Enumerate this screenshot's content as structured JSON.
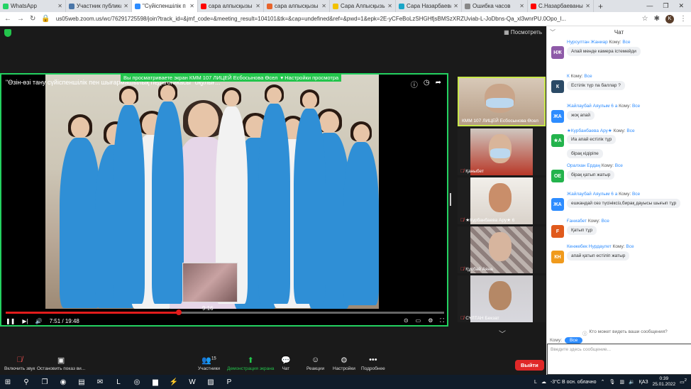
{
  "browser": {
    "tabs": [
      {
        "title": "WhatsApp",
        "color": "#25d366",
        "active": false
      },
      {
        "title": "Участник публикаци",
        "color": "#4a76a8",
        "active": false
      },
      {
        "title": "\"Сүйіспеншілік п",
        "color": "#2d8cff",
        "active": true
      },
      {
        "title": "сара алпысқызы назарбаева",
        "color": "#ff0000",
        "active": false
      },
      {
        "title": "сара алпысқызы на",
        "color": "#e8642c",
        "active": false
      },
      {
        "title": "Сара Алпысқызы На",
        "color": "#f2c200",
        "active": false
      },
      {
        "title": "Сара Назарбаева сл",
        "color": "#1aa6c8",
        "active": false
      },
      {
        "title": "Ошибка часов",
        "color": "#888888",
        "active": false
      },
      {
        "title": "С.Назарбаеваның т",
        "color": "#ff0000",
        "active": false
      }
    ],
    "url": "us05web.zoom.us/wc/76291725598/join?track_id=&jmf_code=&meeting_result=104101&tk=&cap=undefined&ref=&pwd=1&epk=2E-yCFeBoLzSHGHfjsBMSzXRZUviab-L-JoDbns-Qa_xl3wnrPU.0Opo_l...",
    "profile_initial": "K"
  },
  "zoom": {
    "view_button": "Посмотреть",
    "share_banner": "Вы просматриваете экран КММ 107 ЛИЦЕЙ Есбосынова Өсел",
    "share_settings": "Настройки просмотра",
    "video_title": "\"Өзін-өзі тану сүйіспеншілік пен шығармашылық педагогикасы\" оқулығ...",
    "thumb_time": "9:16",
    "progress": 0.395,
    "hover_position": 0.47,
    "time_current": "7:51",
    "time_total": "19:48",
    "participants": [
      {
        "name": "КММ 107 ЛИЦЕЙ Есбосынова Өсел",
        "muted": false
      },
      {
        "name": "Қаныбет",
        "muted": true
      },
      {
        "name": "★Курбанбаева Ару★ 6",
        "muted": true
      },
      {
        "name": "Құлбай Аяна",
        "muted": true
      },
      {
        "name": "СҰЛТАН Бекзат",
        "muted": true
      }
    ]
  },
  "chat": {
    "title": "Чат",
    "messages": [
      {
        "sender": "Нурсултан Жаниар",
        "to_word": "Кому:",
        "to": "Все",
        "initials": "НЖ",
        "color": "#8e5aa8",
        "text": "Апай менде камера істемейди"
      },
      {
        "sender": "К",
        "to_word": "Кому:",
        "to": "Все",
        "initials": "К",
        "color": "#2b4a66",
        "text": "Естілік түр па баллар ?"
      },
      {
        "sender": "Жайлаубай Аяулым 6 а",
        "to_word": "Кому:",
        "to": "Все",
        "initials": "ЖА",
        "color": "#2d8cff",
        "text": "жоқ апай"
      },
      {
        "sender": "★Курбанбаева Ару★",
        "to_word": "Кому:",
        "to": "Все",
        "initials": "★А",
        "color": "#23b34c",
        "text": "Иа апай естілік тұр",
        "extra": "бірақ кідіріпе"
      },
      {
        "sender": "Оралхан Ердаң",
        "to_word": "Кому:",
        "to": "Все",
        "initials": "ОЕ",
        "color": "#23b34c",
        "text": "бірақ қатып жатыр"
      },
      {
        "sender": "Жайлаубай Аяулым 6 а",
        "to_word": "Кому:",
        "to": "Все",
        "initials": "ЖА",
        "color": "#2d8cff",
        "text": "ешкандай сөз түсініксіз,бирақ дауысы шығып тұр"
      },
      {
        "sender": "Ғаниабет",
        "to_word": "Кому:",
        "to": "Все",
        "initials": "F",
        "color": "#e05a1c",
        "text": "Қатып тұр"
      },
      {
        "sender": "Кенжебек Нурдаулет",
        "to_word": "Кому:",
        "to": "Все",
        "initials": "КН",
        "color": "#f09a1c",
        "text": "апай қатып естіліп жатыр"
      }
    ],
    "who_sees": "Кто может видеть ваши сообщения?",
    "to_label": "Кому:",
    "to_value": "Все",
    "input_placeholder": "Введите здесь сообщение..."
  },
  "toolbar": {
    "audio": "Включить звук",
    "video": "Остановить показ ви...",
    "participants": "Участники",
    "participants_count": "15",
    "share": "Демонстрация экрана",
    "chat": "Чат",
    "reactions": "Реакции",
    "settings": "Настройки",
    "more": "Подробнее",
    "leave": "Выйти"
  },
  "taskbar": {
    "weather": "-3°C В осн. облачно",
    "lang": "ҚАЗ",
    "time": "0:39",
    "date": "25.01.2022",
    "notif_count": "2"
  }
}
